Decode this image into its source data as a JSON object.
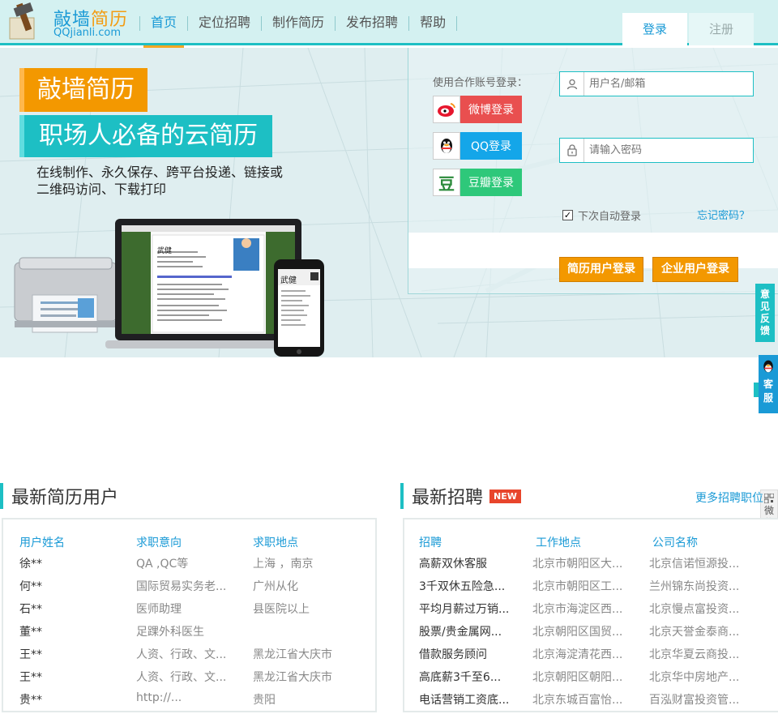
{
  "header": {
    "brand_part1": "敲墙",
    "brand_part2": "简历",
    "brand_url": "QQjianli.com",
    "nav": [
      "首页",
      "定位招聘",
      "制作简历",
      "发布招聘",
      "帮助"
    ],
    "active_nav": 0,
    "login_tab": "登录",
    "register_tab": "注册"
  },
  "hero": {
    "title": "敲墙简历",
    "slogan": "职场人必备的云简历",
    "desc_line1": "在线制作、永久保存、跨平台投递、链接或",
    "desc_line2": "二维码访问、下载打印",
    "laptop_name": "武健",
    "phone_name": "武健"
  },
  "login": {
    "partner_label": "使用合作账号登录：",
    "weibo_label": "微博登录",
    "qq_label": "QQ登录",
    "douban_label": "豆瓣登录",
    "douban_icon_text": "豆",
    "username_placeholder": "用户名/邮箱",
    "password_placeholder": "请输入密码",
    "remember_label": "下次自动登录",
    "remember_checked": true,
    "forgot_label": "忘记密码？",
    "resume_login": "简历用户登录",
    "company_login": "企业用户登录"
  },
  "side": {
    "feedback": "意见反馈",
    "kefu": "客服",
    "wechat": "微信二维码"
  },
  "resumes": {
    "title": "最新简历用户",
    "headers": [
      "用户姓名",
      "求职意向",
      "求职地点"
    ],
    "rows": [
      [
        "徐**",
        "QA ,QC等",
        "上海 ，南京"
      ],
      [
        "何**",
        "国际贸易实务老...",
        "广州从化"
      ],
      [
        "石**",
        "医师助理",
        "县医院以上"
      ],
      [
        "董**",
        "足踝外科医生",
        ""
      ],
      [
        "王**",
        "人资、行政、文...",
        "黑龙江省大庆市"
      ],
      [
        "王**",
        "人资、行政、文...",
        "黑龙江省大庆市"
      ],
      [
        "贵**",
        "http://...",
        "贵阳"
      ]
    ]
  },
  "jobs": {
    "title": "最新招聘",
    "badge": "NEW",
    "more": "更多招聘职位",
    "headers": [
      "招聘",
      "工作地点",
      "公司名称"
    ],
    "rows": [
      [
        "高薪双休客服",
        "北京市朝阳区大...",
        "北京信诺恒源投..."
      ],
      [
        "3千双休五险急...",
        "北京市朝阳区工...",
        "兰州锦东尚投资..."
      ],
      [
        "平均月薪过万销...",
        "北京市海淀区西...",
        "北京慢点富投资..."
      ],
      [
        "股票/贵金属网...",
        "北京朝阳区国贸...",
        "北京天誉金泰商..."
      ],
      [
        "借款服务顾问",
        "北京海淀清花西...",
        "北京华夏云商投..."
      ],
      [
        "高底薪3千至6...",
        "北京朝阳区朝阳...",
        "北京华中房地产..."
      ],
      [
        "电话营销工资底...",
        "北京东城百富怡...",
        "百泓财富投资管..."
      ]
    ]
  },
  "colors": {
    "teal": "#1dbfc4",
    "orange": "#f39800",
    "blue": "#1a9ad6",
    "header_bg": "#d4f1f1"
  }
}
